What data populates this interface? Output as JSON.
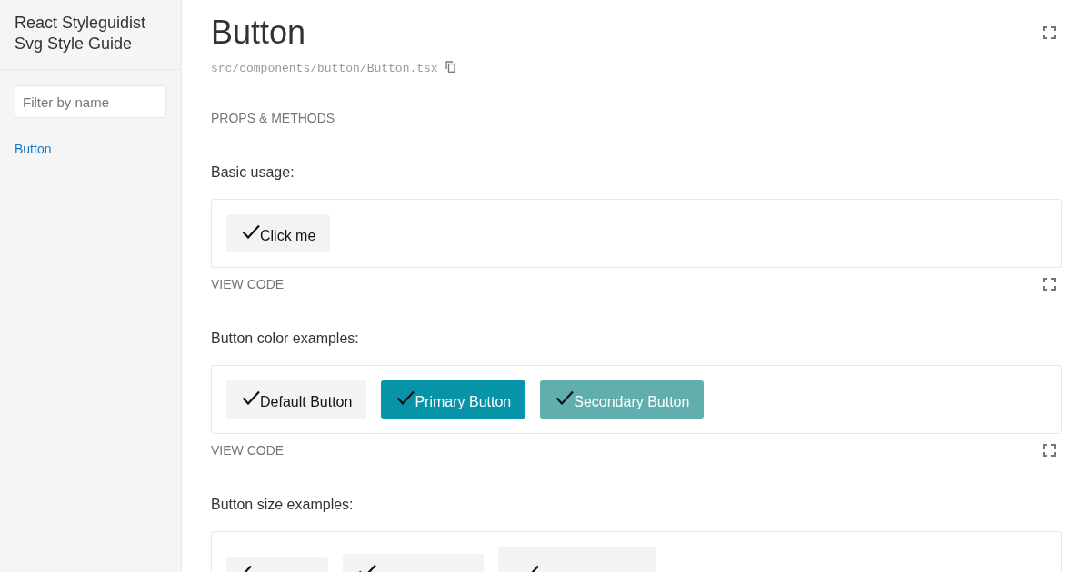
{
  "sidebar": {
    "title": "React Styleguidist Svg Style Guide",
    "filter": {
      "placeholder": "Filter by name"
    },
    "items": [
      {
        "label": "Button"
      }
    ]
  },
  "component": {
    "title": "Button",
    "path": "src/components/button/Button.tsx",
    "props_link": "PROPS & METHODS"
  },
  "examples": [
    {
      "description": "Basic usage:",
      "buttons": [
        {
          "kind": "default",
          "label": "Click me"
        }
      ],
      "view_code": "VIEW CODE"
    },
    {
      "description": "Button color examples:",
      "buttons": [
        {
          "kind": "default",
          "label": "Default Button"
        },
        {
          "kind": "primary",
          "label": "Primary Button"
        },
        {
          "kind": "secondary",
          "label": "Secondary Button"
        }
      ],
      "view_code": "VIEW CODE"
    },
    {
      "description": "Button size examples:",
      "buttons": [
        {
          "kind": "small"
        },
        {
          "kind": "normal"
        },
        {
          "kind": "large"
        }
      ]
    }
  ]
}
